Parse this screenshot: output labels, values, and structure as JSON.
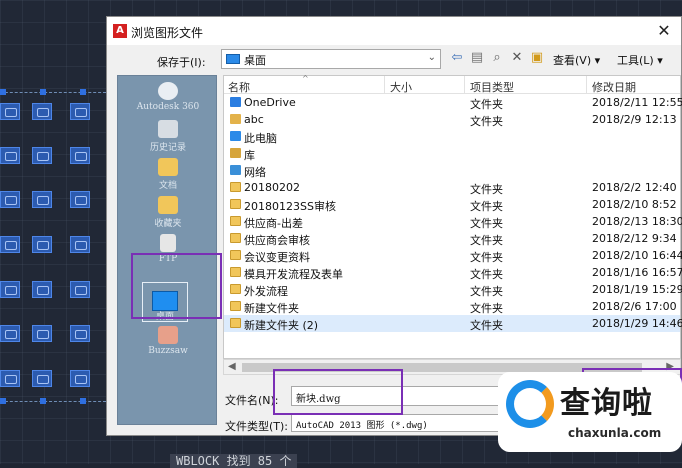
{
  "dialog": {
    "title": "浏览图形文件",
    "close_glyph": "✕",
    "app_icon_letter": "A"
  },
  "toolbar": {
    "save_in_label": "保存于(I):",
    "location_value": "桌面",
    "location_arrow": "⌄",
    "views_label": "查看(V) ▾",
    "tools_label": "工具(L) ▾",
    "icons": [
      "back-arrow-icon",
      "up-folder-icon",
      "search-web-icon",
      "delete-icon",
      "new-folder-icon"
    ],
    "back_glyph": "⇦",
    "up_glyph": "▤",
    "search_glyph": "⌕",
    "delete_glyph": "✕",
    "newfolder_glyph": "▣"
  },
  "places": [
    {
      "label": "Autodesk 360",
      "icon": "cloud-icon"
    },
    {
      "label": "历史记录",
      "icon": "history-icon"
    },
    {
      "label": "文档",
      "icon": "documents-icon"
    },
    {
      "label": "收藏夹",
      "icon": "favorites-icon"
    },
    {
      "label": "FTP",
      "icon": "ftp-icon"
    },
    {
      "label": "桌面",
      "icon": "desktop-icon"
    },
    {
      "label": "Buzzsaw",
      "icon": "buzzsaw-icon"
    }
  ],
  "columns": {
    "name": "名称",
    "size": "大小",
    "type": "项目类型",
    "date": "修改日期"
  },
  "files": [
    {
      "name": "OneDrive",
      "type": "文件夹",
      "date": "2018/2/11 12:55",
      "icon": "onedrive-icon"
    },
    {
      "name": "abc",
      "type": "文件夹",
      "date": "2018/2/9 12:13",
      "icon": "user-folder-icon"
    },
    {
      "name": "此电脑",
      "type": "",
      "date": "",
      "icon": "computer-icon"
    },
    {
      "name": "库",
      "type": "",
      "date": "",
      "icon": "library-icon"
    },
    {
      "name": "网络",
      "type": "",
      "date": "",
      "icon": "network-icon"
    },
    {
      "name": "20180202",
      "type": "文件夹",
      "date": "2018/2/2 12:40",
      "icon": "folder-icon"
    },
    {
      "name": "20180123SS审核",
      "type": "文件夹",
      "date": "2018/2/10 8:52",
      "icon": "folder-icon"
    },
    {
      "name": "供应商-出差",
      "type": "文件夹",
      "date": "2018/2/13 18:30",
      "icon": "folder-icon"
    },
    {
      "name": "供应商会审核",
      "type": "文件夹",
      "date": "2018/2/12 9:34",
      "icon": "folder-icon"
    },
    {
      "name": "会议变更资料",
      "type": "文件夹",
      "date": "2018/2/10 16:44",
      "icon": "folder-icon"
    },
    {
      "name": "模具开发流程及表单",
      "type": "文件夹",
      "date": "2018/1/16 16:57",
      "icon": "folder-icon"
    },
    {
      "name": "外发流程",
      "type": "文件夹",
      "date": "2018/1/19 15:29",
      "icon": "folder-icon"
    },
    {
      "name": "新建文件夹",
      "type": "文件夹",
      "date": "2018/2/6 17:00",
      "icon": "folder-icon"
    },
    {
      "name": "新建文件夹 (2)",
      "type": "文件夹",
      "date": "2018/1/29 14:46",
      "icon": "folder-icon",
      "selected": true
    }
  ],
  "scroll": {
    "left_glyph": "◀",
    "right_glyph": "▶"
  },
  "filename": {
    "label": "文件名(N):",
    "value": "新块.dwg"
  },
  "filetype": {
    "label": "文件类型(T):",
    "value": "AutoCAD 2013 图形 (*.dwg)"
  },
  "command_line": "WBLOCK 找到 85 个",
  "watermark": {
    "title": "查询啦",
    "url": "chaxunla.com"
  },
  "colors": {
    "highlight": "#7a2fb5",
    "selection": "#dcebfc",
    "places_bg": "#7a95ad"
  }
}
